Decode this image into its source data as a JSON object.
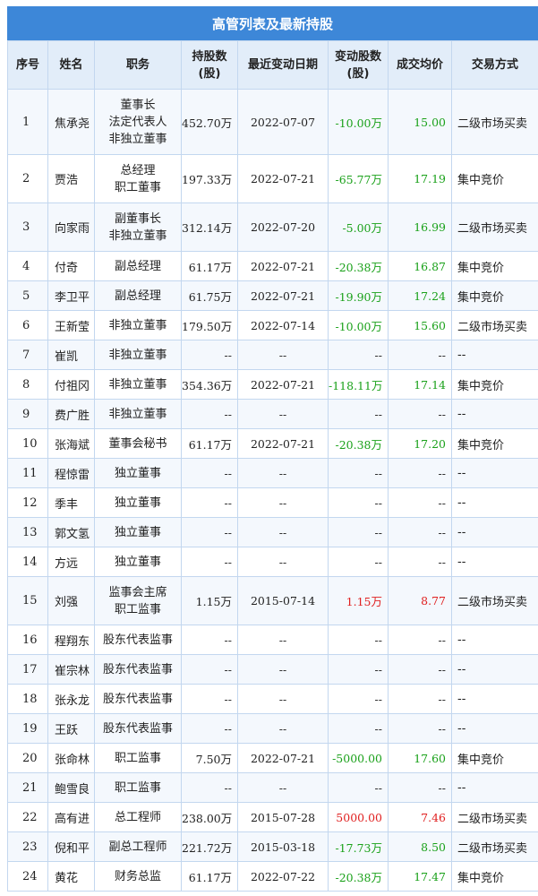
{
  "title": "高管列表及最新持股",
  "headers": {
    "seq": "序号",
    "name": "姓名",
    "position": "职务",
    "holding_1": "持股数",
    "holding_2": "(股)",
    "last_date": "最近变动日期",
    "change_1": "变动股数",
    "change_2": "(股)",
    "avg_price": "成交均价",
    "method": "交易方式"
  },
  "rows": [
    {
      "seq": "1",
      "name": "焦承尧",
      "position": [
        "董事长",
        "法定代表人",
        "非独立董事"
      ],
      "holding": "452.70万",
      "date": "2022-07-07",
      "change": "-10.00万",
      "price": "15.00",
      "method": "二级市场买卖",
      "dir": "neg"
    },
    {
      "seq": "2",
      "name": "贾浩",
      "position": [
        "总经理",
        "职工董事"
      ],
      "holding": "197.33万",
      "date": "2022-07-21",
      "change": "-65.77万",
      "price": "17.19",
      "method": "集中竞价",
      "dir": "neg"
    },
    {
      "seq": "3",
      "name": "向家雨",
      "position": [
        "副董事长",
        "非独立董事"
      ],
      "holding": "312.14万",
      "date": "2022-07-20",
      "change": "-5.00万",
      "price": "16.99",
      "method": "二级市场买卖",
      "dir": "neg"
    },
    {
      "seq": "4",
      "name": "付奇",
      "position": [
        "副总经理"
      ],
      "holding": "61.17万",
      "date": "2022-07-21",
      "change": "-20.38万",
      "price": "16.87",
      "method": "集中竞价",
      "dir": "neg"
    },
    {
      "seq": "5",
      "name": "李卫平",
      "position": [
        "副总经理"
      ],
      "holding": "61.75万",
      "date": "2022-07-21",
      "change": "-19.90万",
      "price": "17.24",
      "method": "集中竞价",
      "dir": "neg"
    },
    {
      "seq": "6",
      "name": "王新莹",
      "position": [
        "非独立董事"
      ],
      "holding": "179.50万",
      "date": "2022-07-14",
      "change": "-10.00万",
      "price": "15.60",
      "method": "二级市场买卖",
      "dir": "neg"
    },
    {
      "seq": "7",
      "name": "崔凯",
      "position": [
        "非独立董事"
      ],
      "holding": "--",
      "date": "--",
      "change": "--",
      "price": "--",
      "method": "--",
      "dir": "none"
    },
    {
      "seq": "8",
      "name": "付祖冈",
      "position": [
        "非独立董事"
      ],
      "holding": "354.36万",
      "date": "2022-07-21",
      "change": "-118.11万",
      "price": "17.14",
      "method": "集中竞价",
      "dir": "neg"
    },
    {
      "seq": "9",
      "name": "费广胜",
      "position": [
        "非独立董事"
      ],
      "holding": "--",
      "date": "--",
      "change": "--",
      "price": "--",
      "method": "--",
      "dir": "none"
    },
    {
      "seq": "10",
      "name": "张海斌",
      "position": [
        "董事会秘书"
      ],
      "holding": "61.17万",
      "date": "2022-07-21",
      "change": "-20.38万",
      "price": "17.20",
      "method": "集中竞价",
      "dir": "neg"
    },
    {
      "seq": "11",
      "name": "程惊雷",
      "position": [
        "独立董事"
      ],
      "holding": "--",
      "date": "--",
      "change": "--",
      "price": "--",
      "method": "--",
      "dir": "none"
    },
    {
      "seq": "12",
      "name": "季丰",
      "position": [
        "独立董事"
      ],
      "holding": "--",
      "date": "--",
      "change": "--",
      "price": "--",
      "method": "--",
      "dir": "none"
    },
    {
      "seq": "13",
      "name": "郭文氢",
      "position": [
        "独立董事"
      ],
      "holding": "--",
      "date": "--",
      "change": "--",
      "price": "--",
      "method": "--",
      "dir": "none"
    },
    {
      "seq": "14",
      "name": "方远",
      "position": [
        "独立董事"
      ],
      "holding": "--",
      "date": "--",
      "change": "--",
      "price": "--",
      "method": "--",
      "dir": "none"
    },
    {
      "seq": "15",
      "name": "刘强",
      "position": [
        "监事会主席",
        "职工监事"
      ],
      "holding": "1.15万",
      "date": "2015-07-14",
      "change": "1.15万",
      "price": "8.77",
      "method": "二级市场买卖",
      "dir": "pos"
    },
    {
      "seq": "16",
      "name": "程翔东",
      "position": [
        "股东代表监事"
      ],
      "holding": "--",
      "date": "--",
      "change": "--",
      "price": "--",
      "method": "--",
      "dir": "none"
    },
    {
      "seq": "17",
      "name": "崔宗林",
      "position": [
        "股东代表监事"
      ],
      "holding": "--",
      "date": "--",
      "change": "--",
      "price": "--",
      "method": "--",
      "dir": "none"
    },
    {
      "seq": "18",
      "name": "张永龙",
      "position": [
        "股东代表监事"
      ],
      "holding": "--",
      "date": "--",
      "change": "--",
      "price": "--",
      "method": "--",
      "dir": "none"
    },
    {
      "seq": "19",
      "name": "王跃",
      "position": [
        "股东代表监事"
      ],
      "holding": "--",
      "date": "--",
      "change": "--",
      "price": "--",
      "method": "--",
      "dir": "none"
    },
    {
      "seq": "20",
      "name": "张命林",
      "position": [
        "职工监事"
      ],
      "holding": "7.50万",
      "date": "2022-07-21",
      "change": "-5000.00",
      "price": "17.60",
      "method": "集中竞价",
      "dir": "neg"
    },
    {
      "seq": "21",
      "name": "鲍雪良",
      "position": [
        "职工监事"
      ],
      "holding": "--",
      "date": "--",
      "change": "--",
      "price": "--",
      "method": "--",
      "dir": "none"
    },
    {
      "seq": "22",
      "name": "高有进",
      "position": [
        "总工程师"
      ],
      "holding": "238.00万",
      "date": "2015-07-28",
      "change": "5000.00",
      "price": "7.46",
      "method": "二级市场买卖",
      "dir": "pos"
    },
    {
      "seq": "23",
      "name": "倪和平",
      "position": [
        "副总工程师"
      ],
      "holding": "221.72万",
      "date": "2015-03-18",
      "change": "-17.73万",
      "price": "8.50",
      "method": "二级市场买卖",
      "dir": "neg"
    },
    {
      "seq": "24",
      "name": "黄花",
      "position": [
        "财务总监"
      ],
      "holding": "61.17万",
      "date": "2022-07-22",
      "change": "-20.38万",
      "price": "17.47",
      "method": "集中竞价",
      "dir": "neg"
    }
  ]
}
